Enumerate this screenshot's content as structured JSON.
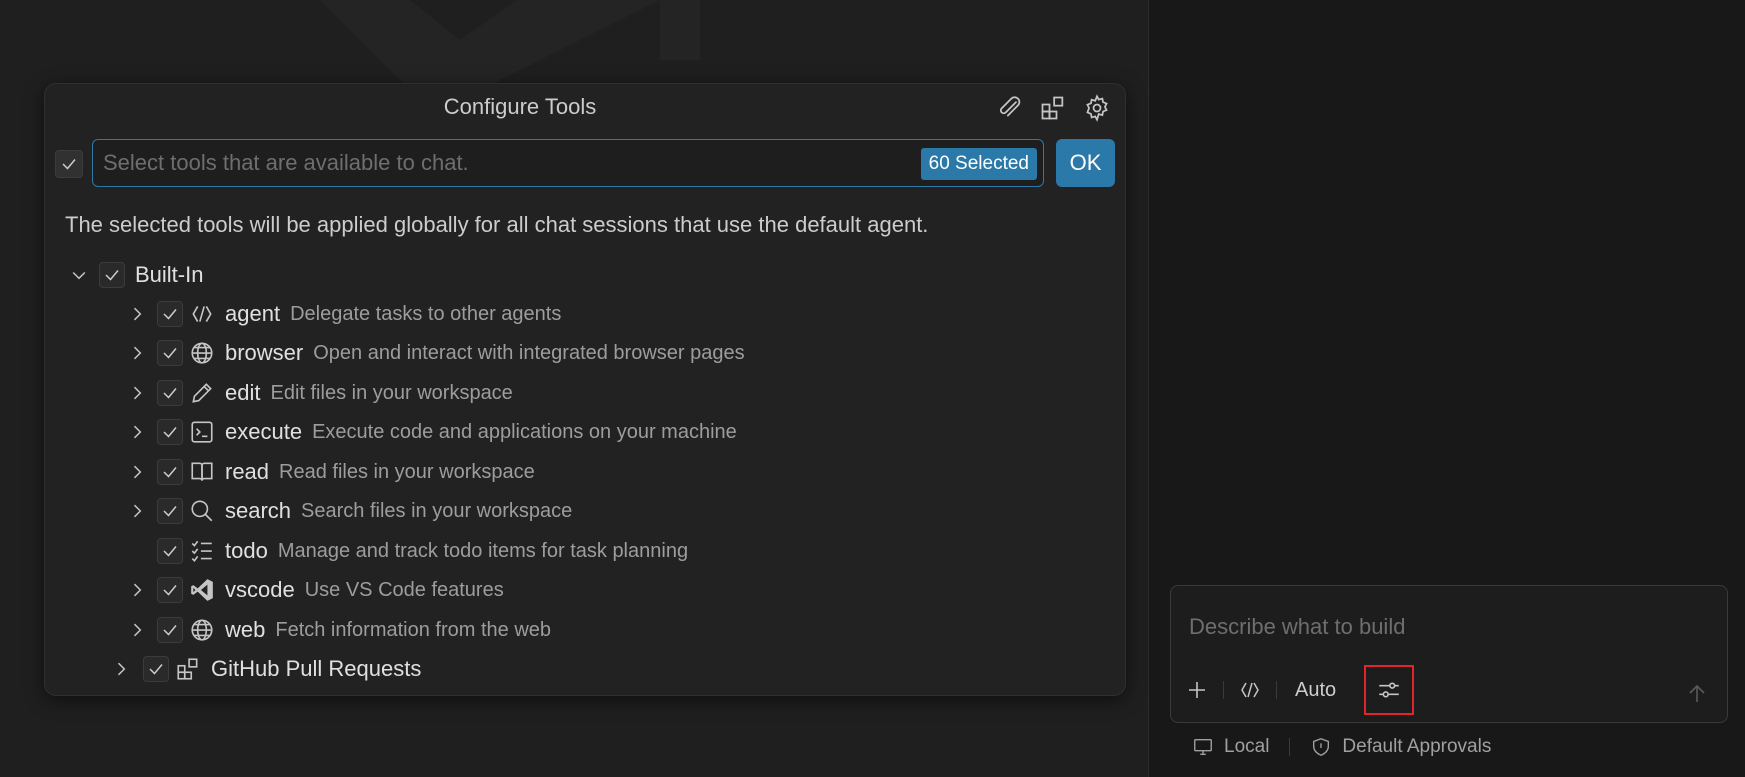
{
  "quick_pick": {
    "title": "Configure Tools",
    "filter_placeholder": "Select tools that are available to chat.",
    "selected_count": "60 Selected",
    "ok_label": "OK",
    "description": "The selected tools will be applied globally for all chat sessions that use the default agent.",
    "title_actions": [
      {
        "icon": "paperclip-icon"
      },
      {
        "icon": "extensions-icon"
      },
      {
        "icon": "gear-icon"
      }
    ],
    "groups": [
      {
        "name": "Built-In",
        "expanded": true,
        "checked": true,
        "tools": [
          {
            "name": "agent",
            "description": "Delegate tasks to other agents",
            "icon": "agent-icon",
            "expandable": true,
            "checked": true
          },
          {
            "name": "browser",
            "description": "Open and interact with integrated browser pages",
            "icon": "globe-icon",
            "expandable": true,
            "checked": true
          },
          {
            "name": "edit",
            "description": "Edit files in your workspace",
            "icon": "pencil-icon",
            "expandable": true,
            "checked": true
          },
          {
            "name": "execute",
            "description": "Execute code and applications on your machine",
            "icon": "terminal-icon",
            "expandable": true,
            "checked": true
          },
          {
            "name": "read",
            "description": "Read files in your workspace",
            "icon": "book-icon",
            "expandable": true,
            "checked": true
          },
          {
            "name": "search",
            "description": "Search files in your workspace",
            "icon": "search-icon",
            "expandable": true,
            "checked": true
          },
          {
            "name": "todo",
            "description": "Manage and track todo items for task planning",
            "icon": "checklist-icon",
            "expandable": false,
            "checked": true
          },
          {
            "name": "vscode",
            "description": "Use VS Code features",
            "icon": "vscode-icon",
            "expandable": true,
            "checked": true
          },
          {
            "name": "web",
            "description": "Fetch information from the web",
            "icon": "globe-icon",
            "expandable": true,
            "checked": true
          }
        ]
      },
      {
        "name": "GitHub Pull Requests",
        "expanded": false,
        "checked": true,
        "icon": "extensions-icon"
      }
    ]
  },
  "chat": {
    "input_placeholder": "Describe what to build",
    "mode_label": "Auto",
    "footer": {
      "local_label": "Local",
      "approvals_label": "Default Approvals"
    }
  },
  "colors": {
    "accent": "#2b79a8",
    "highlight_box": "#e0262a"
  }
}
